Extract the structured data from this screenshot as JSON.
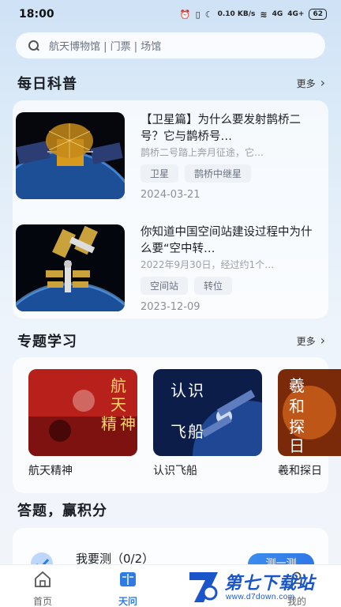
{
  "status_bar": {
    "time": "18:00",
    "network_speed": "0.10 KB/s",
    "signal_1": "4G",
    "signal_2": "4G+",
    "battery": "62"
  },
  "search": {
    "placeholder": "航天博物馆 | 门票 | 场馆"
  },
  "daily_science": {
    "title": "每日科普",
    "more_label": "更多",
    "articles": [
      {
        "title": "【卫星篇】为什么要发射鹊桥二号？它与鹊桥号…",
        "summary": "鹊桥二号踏上奔月征途，它…",
        "tags": [
          "卫星",
          "鹊桥中继星"
        ],
        "date": "2024-03-21"
      },
      {
        "title": "你知道中国空间站建设过程中为什么要“空中转…",
        "summary": "2022年9月30日，经过约1个…",
        "tags": [
          "空间站",
          "转位"
        ],
        "date": "2023-12-09"
      }
    ]
  },
  "topics": {
    "title": "专题学习",
    "more_label": "更多",
    "items": [
      {
        "label": "航天精神",
        "cover_text": [
          "航",
          "天",
          "精",
          "神"
        ],
        "color": "#b8201c"
      },
      {
        "label": "认识飞船",
        "cover_text": [
          "认",
          "识",
          "飞",
          "船"
        ],
        "color": "#0d1d4a"
      },
      {
        "label": "羲和探日",
        "cover_text": [
          "羲",
          "和",
          "探",
          "日"
        ],
        "color": "#7a2a08"
      }
    ]
  },
  "quiz": {
    "title": "答题，赢积分",
    "item_label": "我要测（0/2）",
    "button_label": "测一测"
  },
  "tab_bar": {
    "items": [
      {
        "label": "首页",
        "icon": "home-icon",
        "active": false
      },
      {
        "label": "天问",
        "icon": "book-icon",
        "active": true
      },
      {
        "label": "我的",
        "icon": "user-icon",
        "active": false
      }
    ],
    "accent": "#2f7be6"
  },
  "watermark": {
    "title": "第七下载站",
    "url": "www.d7down.com"
  }
}
